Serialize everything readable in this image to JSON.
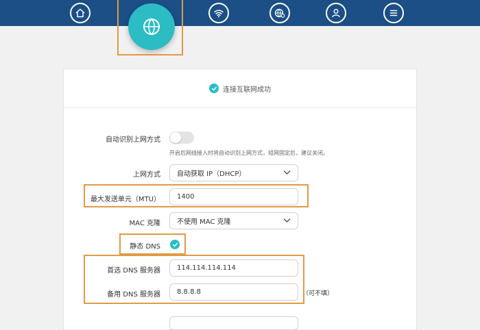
{
  "nav": {
    "items": [
      {
        "icon": "home-icon"
      },
      {
        "icon": "globe-icon",
        "active": true
      },
      {
        "icon": "wifi-icon"
      },
      {
        "icon": "settings-globe-icon"
      },
      {
        "icon": "user-icon"
      },
      {
        "icon": "menu-icon"
      }
    ],
    "colors": {
      "bar": "#1b4f86",
      "accent": "#2bbdc3",
      "highlight": "#e19a45"
    }
  },
  "status": {
    "text": "连接互联网成功"
  },
  "form": {
    "auto_detect": {
      "label": "自动识别上网方式",
      "enabled": false,
      "hint": "开启后网线接入时将自动识别上网方式，组网固定后，建议关闭。"
    },
    "wan_mode": {
      "label": "上网方式",
      "value": "自动获取 IP（DHCP）"
    },
    "mtu": {
      "label": "最大发送单元（MTU）",
      "value": "1400"
    },
    "mac_clone": {
      "label": "MAC 克隆",
      "value": "不使用 MAC 克隆"
    },
    "static_dns": {
      "label": "静态 DNS",
      "checked": true
    },
    "primary_dns": {
      "label": "首选 DNS 服务器",
      "value": "114.114.114.114"
    },
    "secondary_dns": {
      "label": "备用 DNS 服务器",
      "value": "8.8.8.8",
      "note": "（可不填）"
    }
  }
}
